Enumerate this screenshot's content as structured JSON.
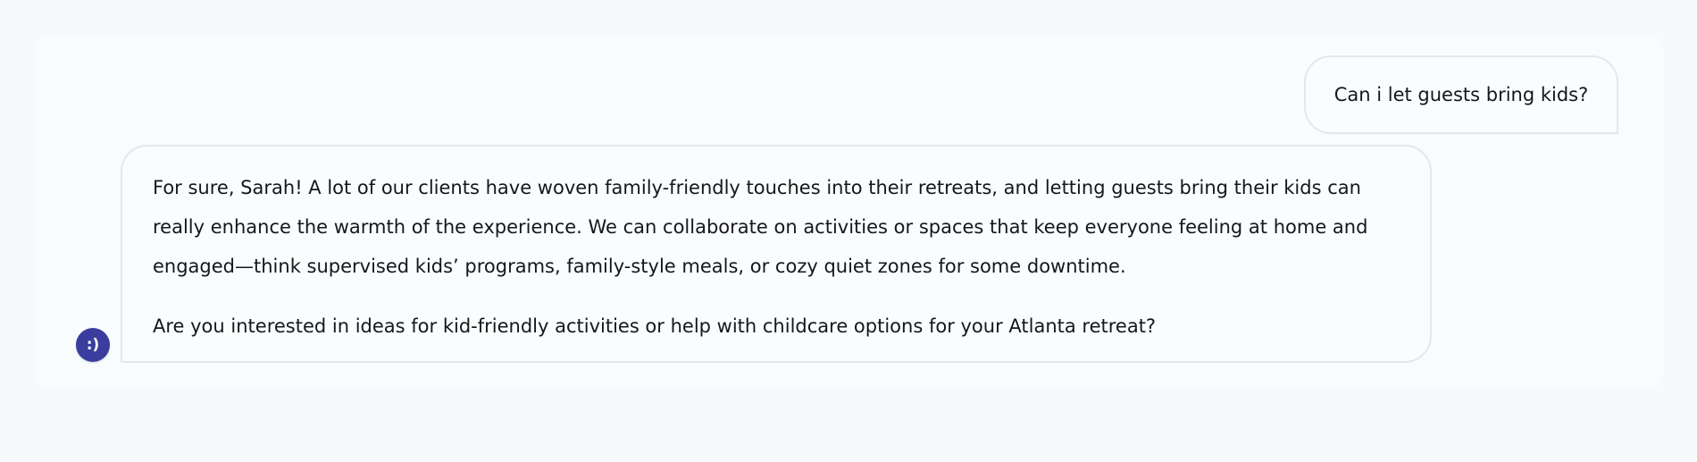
{
  "conversation": {
    "user_message": "Can i let guests bring kids?",
    "assistant_message": {
      "paragraphs": [
        "For sure, Sarah! A lot of our clients have woven family-friendly touches into their retreats, and letting guests bring their kids can really enhance the warmth of the experience. We can collaborate on activities or spaces that keep everyone feeling at home and engaged—think supervised kids’ programs, family-style meals, or cozy quiet zones for some downtime.",
        "Are you interested in ideas for kid-friendly activities or help with childcare options for your Atlanta retreat?"
      ]
    },
    "assistant_avatar": {
      "glyph": ":)",
      "icon": "smiley-avatar-icon",
      "color": "#3a3d9e"
    }
  }
}
